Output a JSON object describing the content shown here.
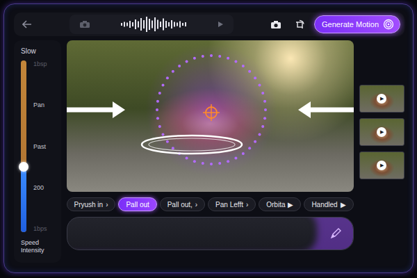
{
  "toolbar": {
    "waveform": [
      4,
      7,
      5,
      10,
      6,
      14,
      9,
      18,
      12,
      22,
      16,
      11,
      20,
      13,
      8,
      17,
      10,
      6,
      12,
      7,
      5,
      9,
      4,
      6
    ]
  },
  "generate_button": {
    "label": "Generate Motion"
  },
  "speed_slider": {
    "top_label": "Slow",
    "ticks": [
      {
        "label": "1bsp",
        "faded": true
      },
      {
        "label": "Pan",
        "faded": false
      },
      {
        "label": "Past",
        "faded": false
      },
      {
        "label": "200",
        "faded": false
      },
      {
        "label": "1bps",
        "faded": true
      }
    ],
    "level": 0.38,
    "caption": "Speed Intensity"
  },
  "motion_presets": [
    {
      "label": "Pryush in",
      "chevron": "›",
      "selected": false
    },
    {
      "label": "Pall out",
      "selected": true
    },
    {
      "label": "Pall out,",
      "chevron": "›",
      "selected": false
    },
    {
      "label": "Pan Lefft",
      "chevron": "›",
      "selected": false
    },
    {
      "label": "Orbita",
      "chevron": "▶",
      "selected": false
    },
    {
      "label": "Handled",
      "chevron": "▶",
      "selected": false
    }
  ],
  "thumbnails": [
    {
      "play": "▶"
    },
    {
      "play": "▶"
    },
    {
      "play": "▶"
    }
  ]
}
